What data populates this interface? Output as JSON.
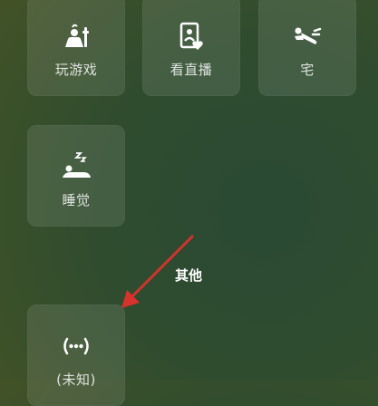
{
  "tiles": [
    {
      "label": "玩游戏",
      "icon": "gaming-figure-icon"
    },
    {
      "label": "看直播",
      "icon": "live-stream-profile-heart-icon"
    },
    {
      "label": "宅",
      "icon": "lying-person-icon"
    },
    {
      "label": "睡觉",
      "icon": "sleeping-zzz-icon"
    },
    {
      "label": "(未知)",
      "icon": "dots-unknown-icon"
    }
  ],
  "annotation": {
    "text": "其他",
    "color": "#ffffff"
  },
  "colors": {
    "arrow": "#d9312b",
    "tile_bg": "rgba(255,255,255,0.10)",
    "icon": "#ffffff"
  }
}
